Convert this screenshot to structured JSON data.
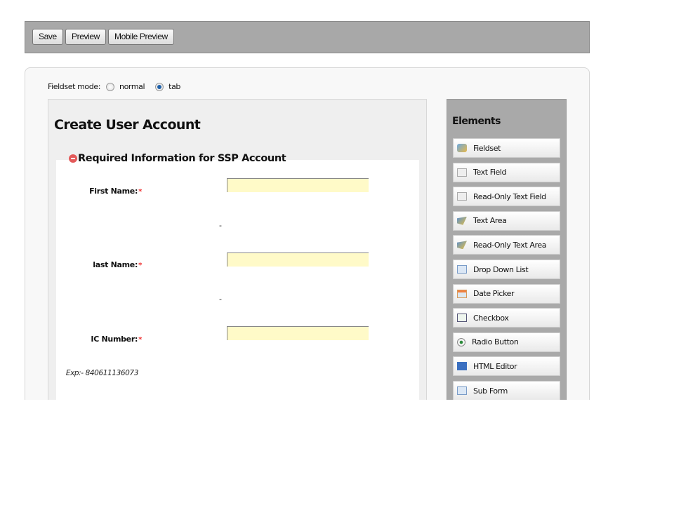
{
  "toolbar": {
    "save": "Save",
    "preview": "Preview",
    "mobile_preview": "Mobile Preview"
  },
  "mode": {
    "label": "Fieldset mode:",
    "normal": "normal",
    "tab": "tab",
    "selected": "tab"
  },
  "form": {
    "title": "Create User Account",
    "fieldset_legend": "Required Information for SSP Account",
    "fields": [
      {
        "label": "First Name:",
        "required": "*",
        "value": "",
        "note": "-"
      },
      {
        "label": "last Name:",
        "required": "*",
        "value": "",
        "note": "-"
      },
      {
        "label": "IC Number:",
        "required": "*",
        "value": "",
        "note": "Exp:- 840611136073"
      }
    ]
  },
  "elements": {
    "title": "Elements",
    "items": [
      {
        "label": "Fieldset",
        "icon": "fieldset-icon"
      },
      {
        "label": "Text Field",
        "icon": "text-field-icon"
      },
      {
        "label": "Read-Only Text Field",
        "icon": "readonly-text-field-icon"
      },
      {
        "label": "Text Area",
        "icon": "text-area-icon"
      },
      {
        "label": "Read-Only Text Area",
        "icon": "readonly-text-area-icon"
      },
      {
        "label": "Drop Down List",
        "icon": "dropdown-icon"
      },
      {
        "label": "Date Picker",
        "icon": "date-picker-icon"
      },
      {
        "label": "Checkbox",
        "icon": "checkbox-icon"
      },
      {
        "label": "Radio Button",
        "icon": "radio-button-icon"
      },
      {
        "label": "HTML Editor",
        "icon": "html-editor-icon"
      },
      {
        "label": "Sub Form",
        "icon": "sub-form-icon"
      }
    ]
  }
}
